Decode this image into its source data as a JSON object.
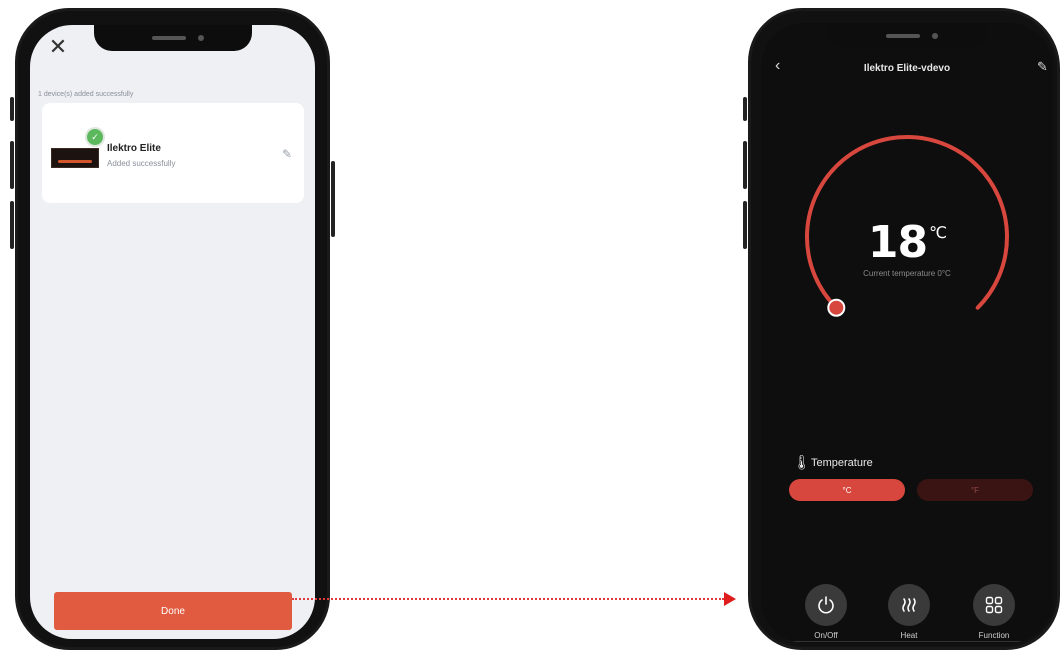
{
  "left_screen": {
    "added_message": "1 device(s) added successfully",
    "device": {
      "name": "Ilektro Elite",
      "status": "Added successfully"
    },
    "done_label": "Done"
  },
  "right_screen": {
    "title": "Ilektro Elite-vdevo",
    "temperature": {
      "value": "18",
      "unit": "℃",
      "current_text": "Current temperature 0°C",
      "dial_level": 0.0
    },
    "temperature_section_label": "Temperature",
    "unit_options": [
      {
        "label": "°C",
        "selected": true
      },
      {
        "label": "°F",
        "selected": false
      }
    ],
    "controls": [
      {
        "label": "On/Off",
        "icon": "power-icon"
      },
      {
        "label": "Heat",
        "icon": "heat-icon"
      },
      {
        "label": "Function",
        "icon": "grid-icon"
      }
    ]
  },
  "colors": {
    "accent_orange": "#e05b3f",
    "accent_red": "#d8473d",
    "success_green": "#5cb85c",
    "arrow_red": "#e01d1d"
  }
}
